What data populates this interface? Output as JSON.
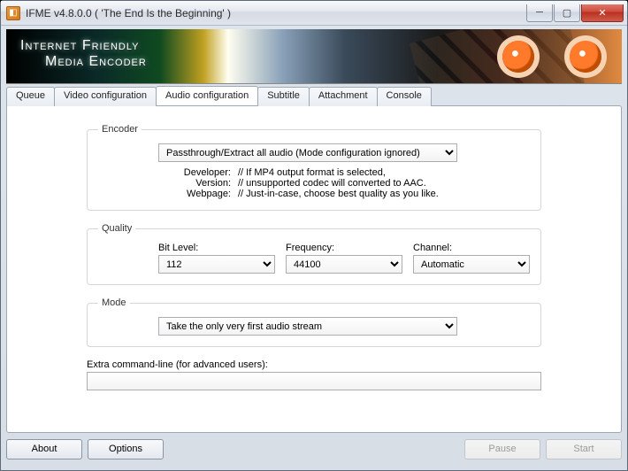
{
  "window": {
    "title": "IFME v4.8.0.0 ( 'The End Is the Beginning' )"
  },
  "banner": {
    "line1": "Internet Friendly",
    "line2": "Media Encoder"
  },
  "tabs": {
    "queue": "Queue",
    "video": "Video configuration",
    "audio": "Audio configuration",
    "subtitle": "Subtitle",
    "attachment": "Attachment",
    "console": "Console"
  },
  "encoder": {
    "legend": "Encoder",
    "selected": "Passthrough/Extract all audio (Mode configuration ignored)",
    "info": {
      "developer_k": "Developer:",
      "developer_v": "// If MP4 output format is selected,",
      "version_k": "Version:",
      "version_v": "// unsupported codec will converted to AAC.",
      "webpage_k": "Webpage:",
      "webpage_v": "// Just-in-case, choose best quality as you like."
    }
  },
  "quality": {
    "legend": "Quality",
    "bit_label": "Bit Level:",
    "bit_value": "112",
    "freq_label": "Frequency:",
    "freq_value": "44100",
    "chan_label": "Channel:",
    "chan_value": "Automatic"
  },
  "mode": {
    "legend": "Mode",
    "selected": "Take the only very first audio stream"
  },
  "extra": {
    "label": "Extra command-line (for advanced users):",
    "value": ""
  },
  "footer": {
    "about": "About",
    "options": "Options",
    "pause": "Pause",
    "start": "Start"
  }
}
